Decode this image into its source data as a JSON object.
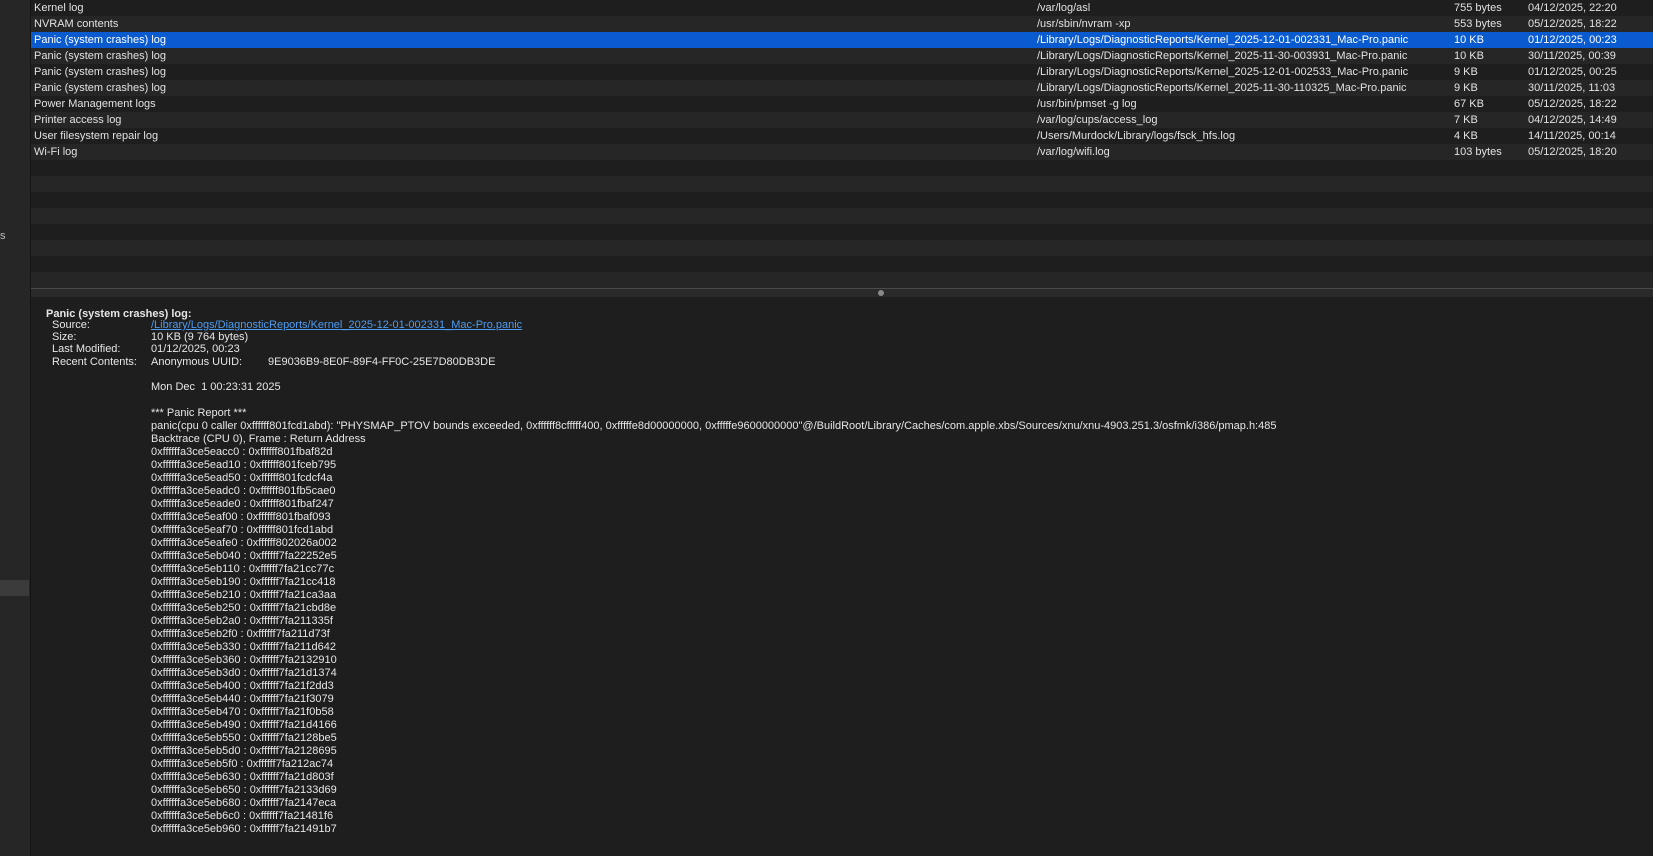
{
  "sidebar": {
    "fragment_text": "s"
  },
  "table": {
    "rows": [
      {
        "name": "Kernel log",
        "path": "/var/log/asl",
        "size": "755 bytes",
        "date": "04/12/2025, 22:20"
      },
      {
        "name": "NVRAM contents",
        "path": "/usr/sbin/nvram -xp",
        "size": "553 bytes",
        "date": "05/12/2025, 18:22"
      },
      {
        "name": "Panic (system crashes) log",
        "path": "/Library/Logs/DiagnosticReports/Kernel_2025-12-01-002331_Mac-Pro.panic",
        "size": "10 KB",
        "date": "01/12/2025, 00:23"
      },
      {
        "name": "Panic (system crashes) log",
        "path": "/Library/Logs/DiagnosticReports/Kernel_2025-11-30-003931_Mac-Pro.panic",
        "size": "10 KB",
        "date": "30/11/2025, 00:39"
      },
      {
        "name": "Panic (system crashes) log",
        "path": "/Library/Logs/DiagnosticReports/Kernel_2025-12-01-002533_Mac-Pro.panic",
        "size": "9 KB",
        "date": "01/12/2025, 00:25"
      },
      {
        "name": "Panic (system crashes) log",
        "path": "/Library/Logs/DiagnosticReports/Kernel_2025-11-30-110325_Mac-Pro.panic",
        "size": "9 KB",
        "date": "30/11/2025, 11:03"
      },
      {
        "name": "Power Management logs",
        "path": "/usr/bin/pmset -g log",
        "size": "67 KB",
        "date": "05/12/2025, 18:22"
      },
      {
        "name": "Printer access log",
        "path": "/var/log/cups/access_log",
        "size": "7 KB",
        "date": "04/12/2025, 14:49"
      },
      {
        "name": "User filesystem repair log",
        "path": "/Users/Murdock/Library/logs/fsck_hfs.log",
        "size": "4 KB",
        "date": "14/11/2025, 00:14"
      },
      {
        "name": "Wi-Fi log",
        "path": "/var/log/wifi.log",
        "size": "103 bytes",
        "date": "05/12/2025, 18:20"
      }
    ],
    "selected_index": 2
  },
  "detail": {
    "title": "Panic (system crashes) log:",
    "source_label": "Source:",
    "source_value": "/Library/Logs/DiagnosticReports/Kernel_2025-12-01-002331_Mac-Pro.panic",
    "size_label": "Size:",
    "size_value": "10 KB (9 764 bytes)",
    "modified_label": "Last Modified:",
    "modified_value": "01/12/2025, 00:23",
    "recent_label": "Recent Contents:",
    "uuid_label": "Anonymous UUID:",
    "uuid_value": "9E9036B9-8E0F-89F4-FF0C-25E7D80DB3DE",
    "date_line": "Mon Dec  1 00:23:31 2025",
    "report_header": "*** Panic Report ***",
    "panic_line": "panic(cpu 0 caller 0xffffff801fcd1abd): \"PHYSMAP_PTOV bounds exceeded, 0xffffff8cfffff400, 0xfffffe8d00000000, 0xfffffe9600000000\"@/BuildRoot/Library/Caches/com.apple.xbs/Sources/xnu/xnu-4903.251.3/osfmk/i386/pmap.h:485",
    "backtrace_header": "Backtrace (CPU 0), Frame : Return Address",
    "backtrace": [
      "0xffffffa3ce5eacc0 : 0xffffff801fbaf82d",
      "0xffffffa3ce5ead10 : 0xffffff801fceb795",
      "0xffffffa3ce5ead50 : 0xffffff801fcdcf4a",
      "0xffffffa3ce5eadc0 : 0xffffff801fb5cae0",
      "0xffffffa3ce5eade0 : 0xffffff801fbaf247",
      "0xffffffa3ce5eaf00 : 0xffffff801fbaf093",
      "0xffffffa3ce5eaf70 : 0xffffff801fcd1abd",
      "0xffffffa3ce5eafe0 : 0xffffff802026a002",
      "0xffffffa3ce5eb040 : 0xffffff7fa22252e5",
      "0xffffffa3ce5eb110 : 0xffffff7fa21cc77c",
      "0xffffffa3ce5eb190 : 0xffffff7fa21cc418",
      "0xffffffa3ce5eb210 : 0xffffff7fa21ca3aa",
      "0xffffffa3ce5eb250 : 0xffffff7fa21cbd8e",
      "0xffffffa3ce5eb2a0 : 0xffffff7fa211335f",
      "0xffffffa3ce5eb2f0 : 0xffffff7fa211d73f",
      "0xffffffa3ce5eb330 : 0xffffff7fa211d642",
      "0xffffffa3ce5eb360 : 0xffffff7fa2132910",
      "0xffffffa3ce5eb3d0 : 0xffffff7fa21d1374",
      "0xffffffa3ce5eb400 : 0xffffff7fa21f2dd3",
      "0xffffffa3ce5eb440 : 0xffffff7fa21f3079",
      "0xffffffa3ce5eb470 : 0xffffff7fa21f0b58",
      "0xffffffa3ce5eb490 : 0xffffff7fa21d4166",
      "0xffffffa3ce5eb550 : 0xffffff7fa2128be5",
      "0xffffffa3ce5eb5d0 : 0xffffff7fa2128695",
      "0xffffffa3ce5eb5f0 : 0xffffff7fa212ac74",
      "0xffffffa3ce5eb630 : 0xffffff7fa21d803f",
      "0xffffffa3ce5eb650 : 0xffffff7fa2133d69",
      "0xffffffa3ce5eb680 : 0xffffff7fa2147eca",
      "0xffffffa3ce5eb6c0 : 0xffffff7fa21481f6",
      "0xffffffa3ce5eb960 : 0xffffff7fa21491b7"
    ]
  }
}
